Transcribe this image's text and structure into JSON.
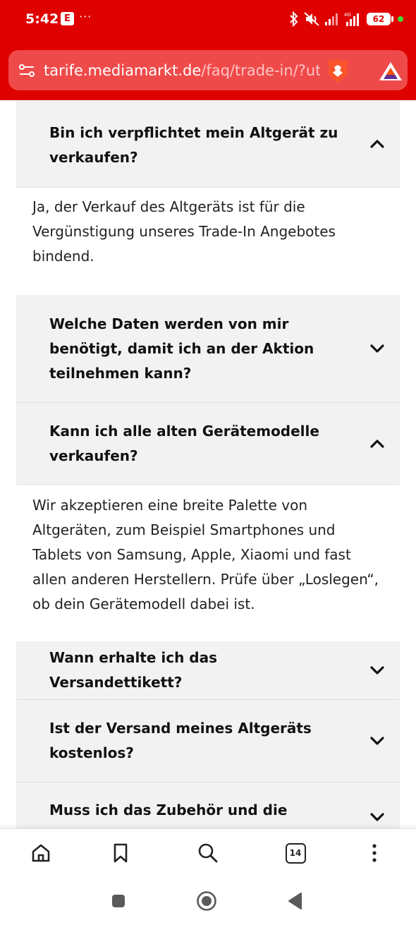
{
  "status_bar": {
    "time": "5:42",
    "notification_badge": "E",
    "more_dots": "···",
    "battery": "62"
  },
  "browser": {
    "url_domain": "tarife.mediamarkt.de",
    "url_path": "/faq/trade-in/?ut",
    "tab_count": "14"
  },
  "faq": [
    {
      "question": "Bin ich verpflichtet mein Altgerät zu verkaufen?",
      "expanded": true,
      "answer": "Ja, der Verkauf des Altgeräts ist für die Vergünstigung unseres Trade-In Angebotes bindend."
    },
    {
      "question": "Welche Daten werden von mir benötigt, damit ich an der Aktion teilnehmen kann?",
      "expanded": false
    },
    {
      "question": "Kann ich alle alten Gerätemodelle verkaufen?",
      "expanded": true,
      "answer": "Wir akzeptieren eine breite Palette von Altgeräten, zum Beispiel Smartphones und Tablets von Samsung, Apple, Xiaomi und fast allen anderen Herstellern. Prüfe über „Loslegen“, ob dein Gerätemodell dabei ist."
    },
    {
      "question": "Wann erhalte ich das Versandettikett?",
      "expanded": false
    },
    {
      "question": "Ist der Versand meines Altgeräts kostenlos?",
      "expanded": false
    },
    {
      "question": "Muss ich das Zubehör und die",
      "expanded": false
    }
  ],
  "colors": {
    "chrome_red": "#df0000",
    "url_bar": "#ef4a4a",
    "question_bg": "#f2f2f2"
  }
}
